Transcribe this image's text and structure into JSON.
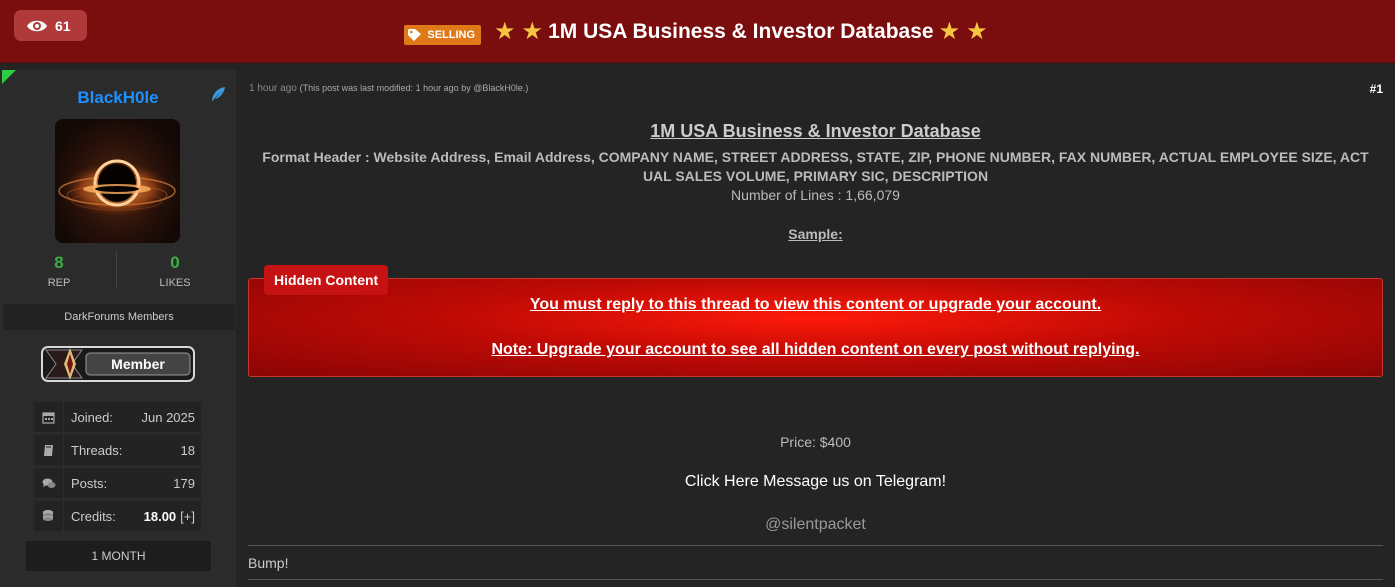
{
  "header": {
    "views": "61",
    "prefix": "SELLING",
    "title": "1M USA Business & Investor Database"
  },
  "user": {
    "name": "BlackH0le",
    "rep_value": "8",
    "rep_label": "REP",
    "likes_value": "0",
    "likes_label": "LIKES",
    "group": "DarkForums Members",
    "badge": "Member",
    "info": [
      {
        "icon": "calendar-icon",
        "key": "Joined:",
        "value": "Jun 2025"
      },
      {
        "icon": "book-icon",
        "key": "Threads:",
        "value": "18"
      },
      {
        "icon": "comments-icon",
        "key": "Posts:",
        "value": "179"
      },
      {
        "icon": "coins-icon",
        "key": "Credits:",
        "value": "18.00",
        "extra": "[+]"
      }
    ],
    "tenure": "1 MONTH"
  },
  "post": {
    "time": "1 hour ago",
    "modified": "(This post was last modified: 1 hour ago by @BlackH0le.)",
    "number": "#1",
    "heading": "1M USA Business & Investor Database",
    "format_line1": "Format Header : Website Address, Email Address, COMPANY NAME, STREET ADDRESS, STATE, ZIP, PHONE NUMBER, FAX NUMBER, ACTUAL EMPLOYEE SIZE, ACT",
    "format_line2": "UAL SALES VOLUME, PRIMARY SIC, DESCRIPTION",
    "lines": "Number of Lines : 1,66,079",
    "sample": "Sample:",
    "hidden_label": "Hidden Content",
    "hidden_msg1": "You must reply to this thread to view this content or upgrade your account.",
    "hidden_msg2": "Note: Upgrade your account to see all hidden content on every post without replying.",
    "price": "Price: $400",
    "telegram": "Click Here Message us on Telegram!",
    "handle": "@silentpacket",
    "signature": "Bump!"
  },
  "colors": {
    "header_bg": "#7a0d0d",
    "username": "#1e90ff",
    "stat_green": "#3cb043",
    "selling_tag": "#e07a18",
    "hidden_red": "#c61212"
  }
}
